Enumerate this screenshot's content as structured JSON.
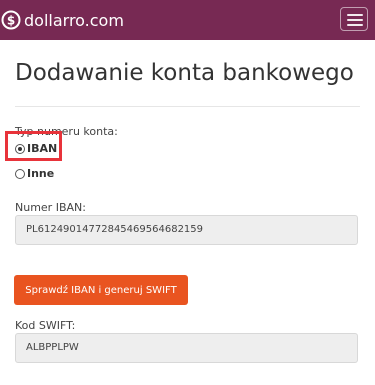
{
  "header": {
    "brand": "dollarro.com",
    "menu_icon": "hamburger-menu-icon",
    "colors": {
      "navbar": "#772953"
    }
  },
  "page": {
    "title": "Dodawanie konta bankowego"
  },
  "form": {
    "account_type_label": "Typ numeru konta:",
    "options": [
      {
        "label": "IBAN",
        "checked": true
      },
      {
        "label": "Inne",
        "checked": false
      }
    ],
    "iban_label": "Numer IBAN:",
    "iban_value": "PL61249014772845469564682159",
    "submit_label": "Sprawdź IBAN i generuj SWIFT",
    "swift_label": "Kod SWIFT:",
    "swift_value": "ALBPPLPW",
    "colors": {
      "button": "#e95420",
      "highlight": "#e8333a"
    }
  }
}
